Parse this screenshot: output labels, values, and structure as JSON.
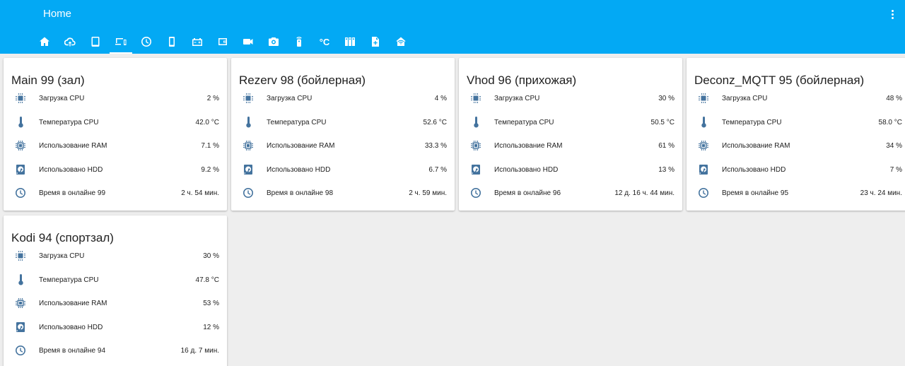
{
  "header": {
    "title": "Home",
    "tabs": [
      {
        "icon": "home-icon",
        "active": false
      },
      {
        "icon": "cloud-upload-icon",
        "active": false
      },
      {
        "icon": "tablet-icon",
        "active": false
      },
      {
        "icon": "devices-icon",
        "active": true
      },
      {
        "icon": "clock-icon",
        "active": false
      },
      {
        "icon": "phone-icon",
        "active": false
      },
      {
        "icon": "car-battery-icon",
        "active": false
      },
      {
        "icon": "wallet-icon",
        "active": false
      },
      {
        "icon": "video-icon",
        "active": false
      },
      {
        "icon": "camera-icon",
        "active": false
      },
      {
        "icon": "remote-icon",
        "active": false
      },
      {
        "icon": "celsius-icon",
        "label": "°C",
        "active": false
      },
      {
        "icon": "server-icon",
        "active": false
      },
      {
        "icon": "file-plus-icon",
        "active": false
      },
      {
        "icon": "home-wifi-icon",
        "active": false
      }
    ]
  },
  "cards": [
    {
      "title": "Main 99 (зал)",
      "rows": [
        {
          "icon": "cpu-icon",
          "label": "Загрузка CPU",
          "value": "2 %"
        },
        {
          "icon": "thermometer-icon",
          "label": "Температура CPU",
          "value": "42.0 °C"
        },
        {
          "icon": "memory-icon",
          "label": "Использование RAM",
          "value": "7.1 %"
        },
        {
          "icon": "harddisk-icon",
          "label": "Использовано HDD",
          "value": "9.2 %"
        },
        {
          "icon": "clock-icon",
          "label": "Время в онлайне 99",
          "value": "2 ч. 54 мин."
        }
      ]
    },
    {
      "title": "Rezerv 98 (бойлерная)",
      "rows": [
        {
          "icon": "cpu-icon",
          "label": "Загрузка CPU",
          "value": "4 %"
        },
        {
          "icon": "thermometer-icon",
          "label": "Температура CPU",
          "value": "52.6 °C"
        },
        {
          "icon": "memory-icon",
          "label": "Использование RAM",
          "value": "33.3 %"
        },
        {
          "icon": "harddisk-icon",
          "label": "Использовано HDD",
          "value": "6.7 %"
        },
        {
          "icon": "clock-icon",
          "label": "Время в онлайне 98",
          "value": "2 ч. 59 мин."
        }
      ]
    },
    {
      "title": "Vhod 96 (прихожая)",
      "rows": [
        {
          "icon": "cpu-icon",
          "label": "Загрузка CPU",
          "value": "30 %"
        },
        {
          "icon": "thermometer-icon",
          "label": "Температура CPU",
          "value": "50.5 °C"
        },
        {
          "icon": "memory-icon",
          "label": "Использование RAM",
          "value": "61 %"
        },
        {
          "icon": "harddisk-icon",
          "label": "Использовано HDD",
          "value": "13 %"
        },
        {
          "icon": "clock-icon",
          "label": "Время в онлайне 96",
          "value": "12 д. 16 ч. 44 мин."
        }
      ]
    },
    {
      "title": "Deconz_MQTT 95 (бойлерная)",
      "rows": [
        {
          "icon": "cpu-icon",
          "label": "Загрузка CPU",
          "value": "48 %"
        },
        {
          "icon": "thermometer-icon",
          "label": "Температура CPU",
          "value": "58.0 °C"
        },
        {
          "icon": "memory-icon",
          "label": "Использование RAM",
          "value": "34 %"
        },
        {
          "icon": "harddisk-icon",
          "label": "Использовано HDD",
          "value": "7 %"
        },
        {
          "icon": "clock-icon",
          "label": "Время в онлайне 95",
          "value": "23 ч. 24 мин."
        }
      ]
    },
    {
      "title": "Kodi 94 (спортзал)",
      "rows": [
        {
          "icon": "cpu-icon",
          "label": "Загрузка CPU",
          "value": "30 %"
        },
        {
          "icon": "thermometer-icon",
          "label": "Температура CPU",
          "value": "47.8 °C"
        },
        {
          "icon": "memory-icon",
          "label": "Использование RAM",
          "value": "53 %"
        },
        {
          "icon": "harddisk-icon",
          "label": "Использовано HDD",
          "value": "12 %"
        },
        {
          "icon": "clock-icon",
          "label": "Время в онлайне 94",
          "value": "16 д. 7 мин."
        }
      ]
    }
  ]
}
